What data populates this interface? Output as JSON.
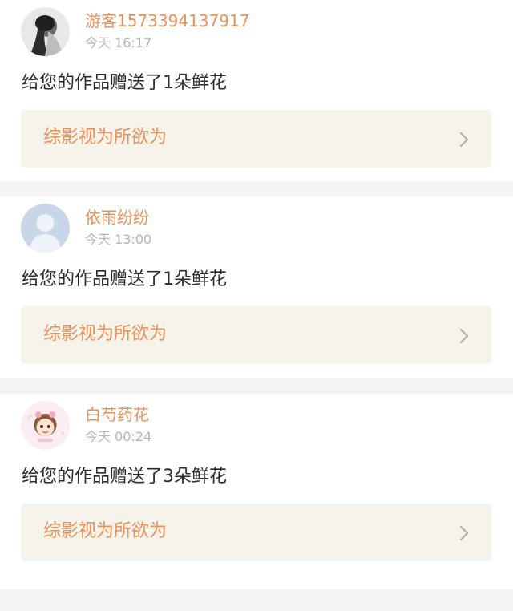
{
  "notifications": [
    {
      "username": "游客1573394137917",
      "time": "今天 16:17",
      "message": "给您的作品赠送了1朵鲜花",
      "work_title": "综影视为所欲为",
      "avatar_icon": "photo-avatar-icon"
    },
    {
      "username": "依雨纷纷",
      "time": "今天 13:00",
      "message": "给您的作品赠送了1朵鲜花",
      "work_title": "综影视为所欲为",
      "avatar_icon": "default-user-avatar-icon"
    },
    {
      "username": "白芍药花",
      "time": "今天 00:24",
      "message": "给您的作品赠送了3朵鲜花",
      "work_title": "综影视为所欲为",
      "avatar_icon": "cartoon-avatar-icon"
    }
  ],
  "colors": {
    "accent": "#e9915a",
    "card_link_bg": "#f5f3ea",
    "divider": "#f4f4f4",
    "timestamp": "#b4b4b4",
    "message_text": "#2a2a2a"
  }
}
